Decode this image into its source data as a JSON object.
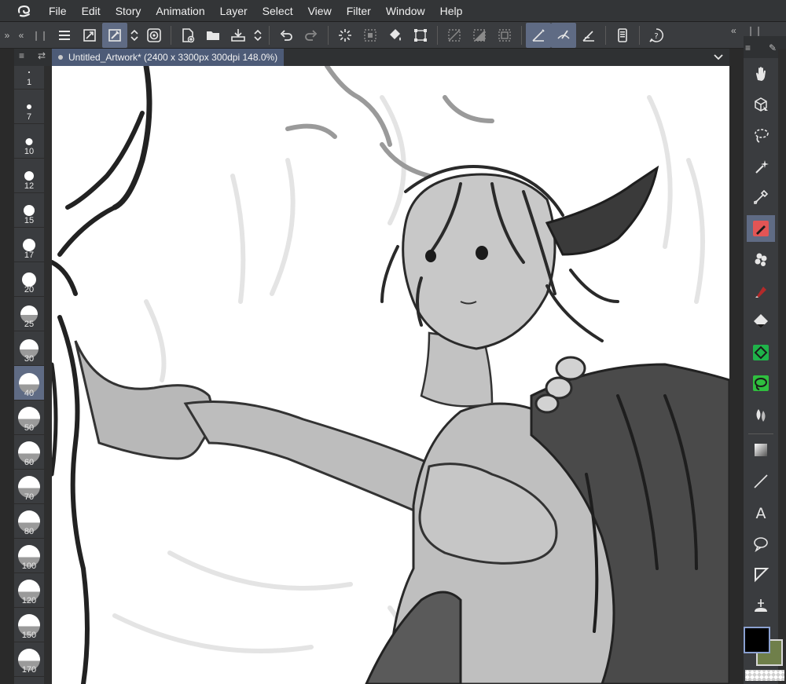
{
  "menubar": {
    "items": [
      "File",
      "Edit",
      "Story",
      "Animation",
      "Layer",
      "Select",
      "View",
      "Filter",
      "Window",
      "Help"
    ]
  },
  "toolbar": {
    "icons": [
      "menu-icon",
      "fit-view-icon",
      "brush-tool-icon",
      "stepper-icon",
      "stabilizer-icon",
      "new-icon",
      "open-icon",
      "save-icon",
      "stepper-icon",
      "undo-icon",
      "redo-icon",
      "loading-icon",
      "deselect-icon",
      "fill-icon",
      "transform-icon",
      "clear-selection-icon",
      "invert-icon",
      "border-icon",
      "snap-ruler-icon",
      "snap-special-icon",
      "snap-grid-icon",
      "tablet-icon",
      "help-icon"
    ]
  },
  "document": {
    "tab_label": "Untitled_Artwork* (2400 x 3300px 300dpi 148.0%)"
  },
  "brush_sizes": {
    "items": [
      {
        "label": "1"
      },
      {
        "label": "7"
      },
      {
        "label": "10"
      },
      {
        "label": "12"
      },
      {
        "label": "15"
      },
      {
        "label": "17"
      },
      {
        "label": "20"
      },
      {
        "label": "25"
      },
      {
        "label": "30"
      },
      {
        "label": "40"
      },
      {
        "label": "50"
      },
      {
        "label": "60"
      },
      {
        "label": "70"
      },
      {
        "label": "80"
      },
      {
        "label": "100"
      },
      {
        "label": "120"
      },
      {
        "label": "150"
      },
      {
        "label": "170"
      }
    ],
    "selected": "40"
  },
  "tools": {
    "items": [
      "hand-icon",
      "object-select-icon",
      "lasso-icon",
      "magic-wand-icon",
      "eyedropper-icon",
      "pen-icon",
      "decoration-icon",
      "marker-icon",
      "eraser-icon",
      "fill-bucket-icon",
      "lasso-fill-icon",
      "blend-icon",
      "gradient-icon",
      "line-icon",
      "text-icon",
      "speech-balloon-icon",
      "frame-border-icon",
      "ruler-icon"
    ],
    "active": "pen-icon"
  },
  "colors": {
    "main": "#000000",
    "sub": "#6f7f4a",
    "accent": "#5f6b84"
  }
}
